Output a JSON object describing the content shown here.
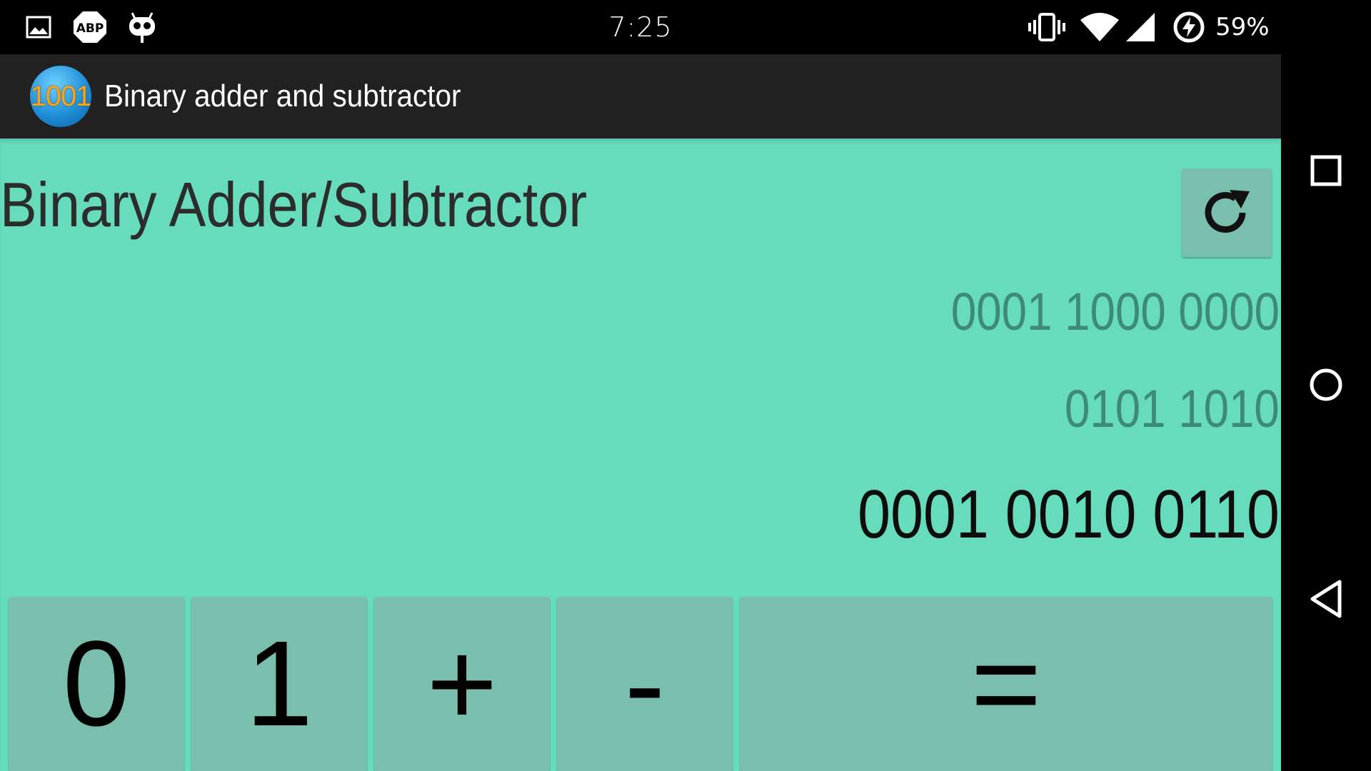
{
  "status_bar": {
    "time": "7:25",
    "battery_percent": "59%",
    "left_icons": [
      "image-notification-icon",
      "abp-icon",
      "cyanogenmod-icon"
    ],
    "right_icons": [
      "vibrate-icon",
      "wifi-icon",
      "signal-icon",
      "battery-charging-icon"
    ],
    "abp_label": "ABP"
  },
  "action_bar": {
    "app_icon_text": "1001",
    "title": "Binary adder and subtractor"
  },
  "main": {
    "heading": "Binary Adder/Subtractor",
    "reset_icon": "refresh-icon",
    "operand_a": "0001 1000 0000",
    "operand_b": "0101 1010",
    "result": "0001 0010 0110"
  },
  "keypad": {
    "keys": [
      {
        "label": "0"
      },
      {
        "label": "1"
      },
      {
        "label": "+"
      },
      {
        "label": "-"
      },
      {
        "label": "="
      }
    ]
  },
  "nav_bar": {
    "icons": [
      "recents-icon",
      "home-icon",
      "back-icon"
    ]
  },
  "colors": {
    "content_bg": "#66dcbd",
    "button_bg": "#7abfad",
    "action_bar_bg": "#212121",
    "operand_text": "#3d8a77"
  }
}
